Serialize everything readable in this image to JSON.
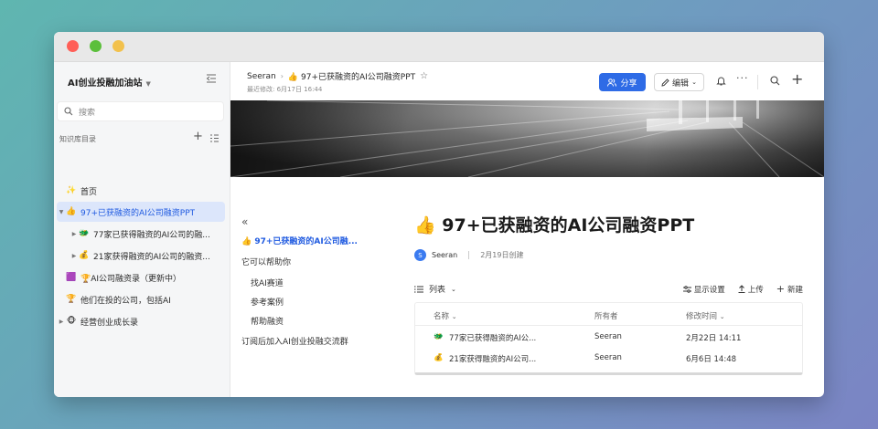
{
  "workspace": {
    "name": "AI创业投融加油站"
  },
  "sidebar": {
    "search_placeholder": "搜索",
    "section_title": "知识库目录",
    "items": [
      {
        "emoji": "✨",
        "label": "首页"
      },
      {
        "emoji": "👍",
        "label": "97+已获融资的AI公司融资PPT"
      },
      {
        "emoji": "🐲",
        "label": "77家已获得融资的AI公司的融..."
      },
      {
        "emoji": "💰",
        "label": "21家获得融资的AI公司的融资..."
      },
      {
        "emoji": "🟪",
        "label": "🏆AI公司融资录（更新中）"
      },
      {
        "emoji": "🏆",
        "label": "他们在投的公司，包括AI"
      },
      {
        "emoji": "🐵",
        "label": "经营创业成长录"
      }
    ]
  },
  "header": {
    "breadcrumb_root": "Seeran",
    "breadcrumb_current": "👍 97+已获融资的AI公司融资PPT",
    "last_edited": "最近修改: 6月17日 16:44",
    "share_label": "分享",
    "edit_label": "编辑"
  },
  "toc": {
    "items": [
      "👍 97+已获融资的AI公司融...",
      "它可以帮助你",
      "找AI赛道",
      "参考案例",
      "帮助融资",
      "订阅后加入AI创业投融交流群"
    ]
  },
  "doc": {
    "title": "👍 97+已获融资的AI公司融资PPT",
    "author_initial": "S",
    "author": "Seeran",
    "created": "2月19日创建"
  },
  "view": {
    "mode_label": "列表",
    "display_settings": "显示设置",
    "upload": "上传",
    "new": "新建"
  },
  "table": {
    "headers": [
      "名称",
      "所有者",
      "修改时间"
    ],
    "rows": [
      {
        "emoji": "🐲",
        "name": "77家已获得融资的AI公...",
        "owner": "Seeran",
        "modified": "2月22日 14:11"
      },
      {
        "emoji": "💰",
        "name": "21家获得融资的AI公司...",
        "owner": "Seeran",
        "modified": "6月6日 14:48"
      }
    ]
  },
  "colors": {
    "accent": "#2e6be6",
    "active_bg": "#dce6fb"
  }
}
